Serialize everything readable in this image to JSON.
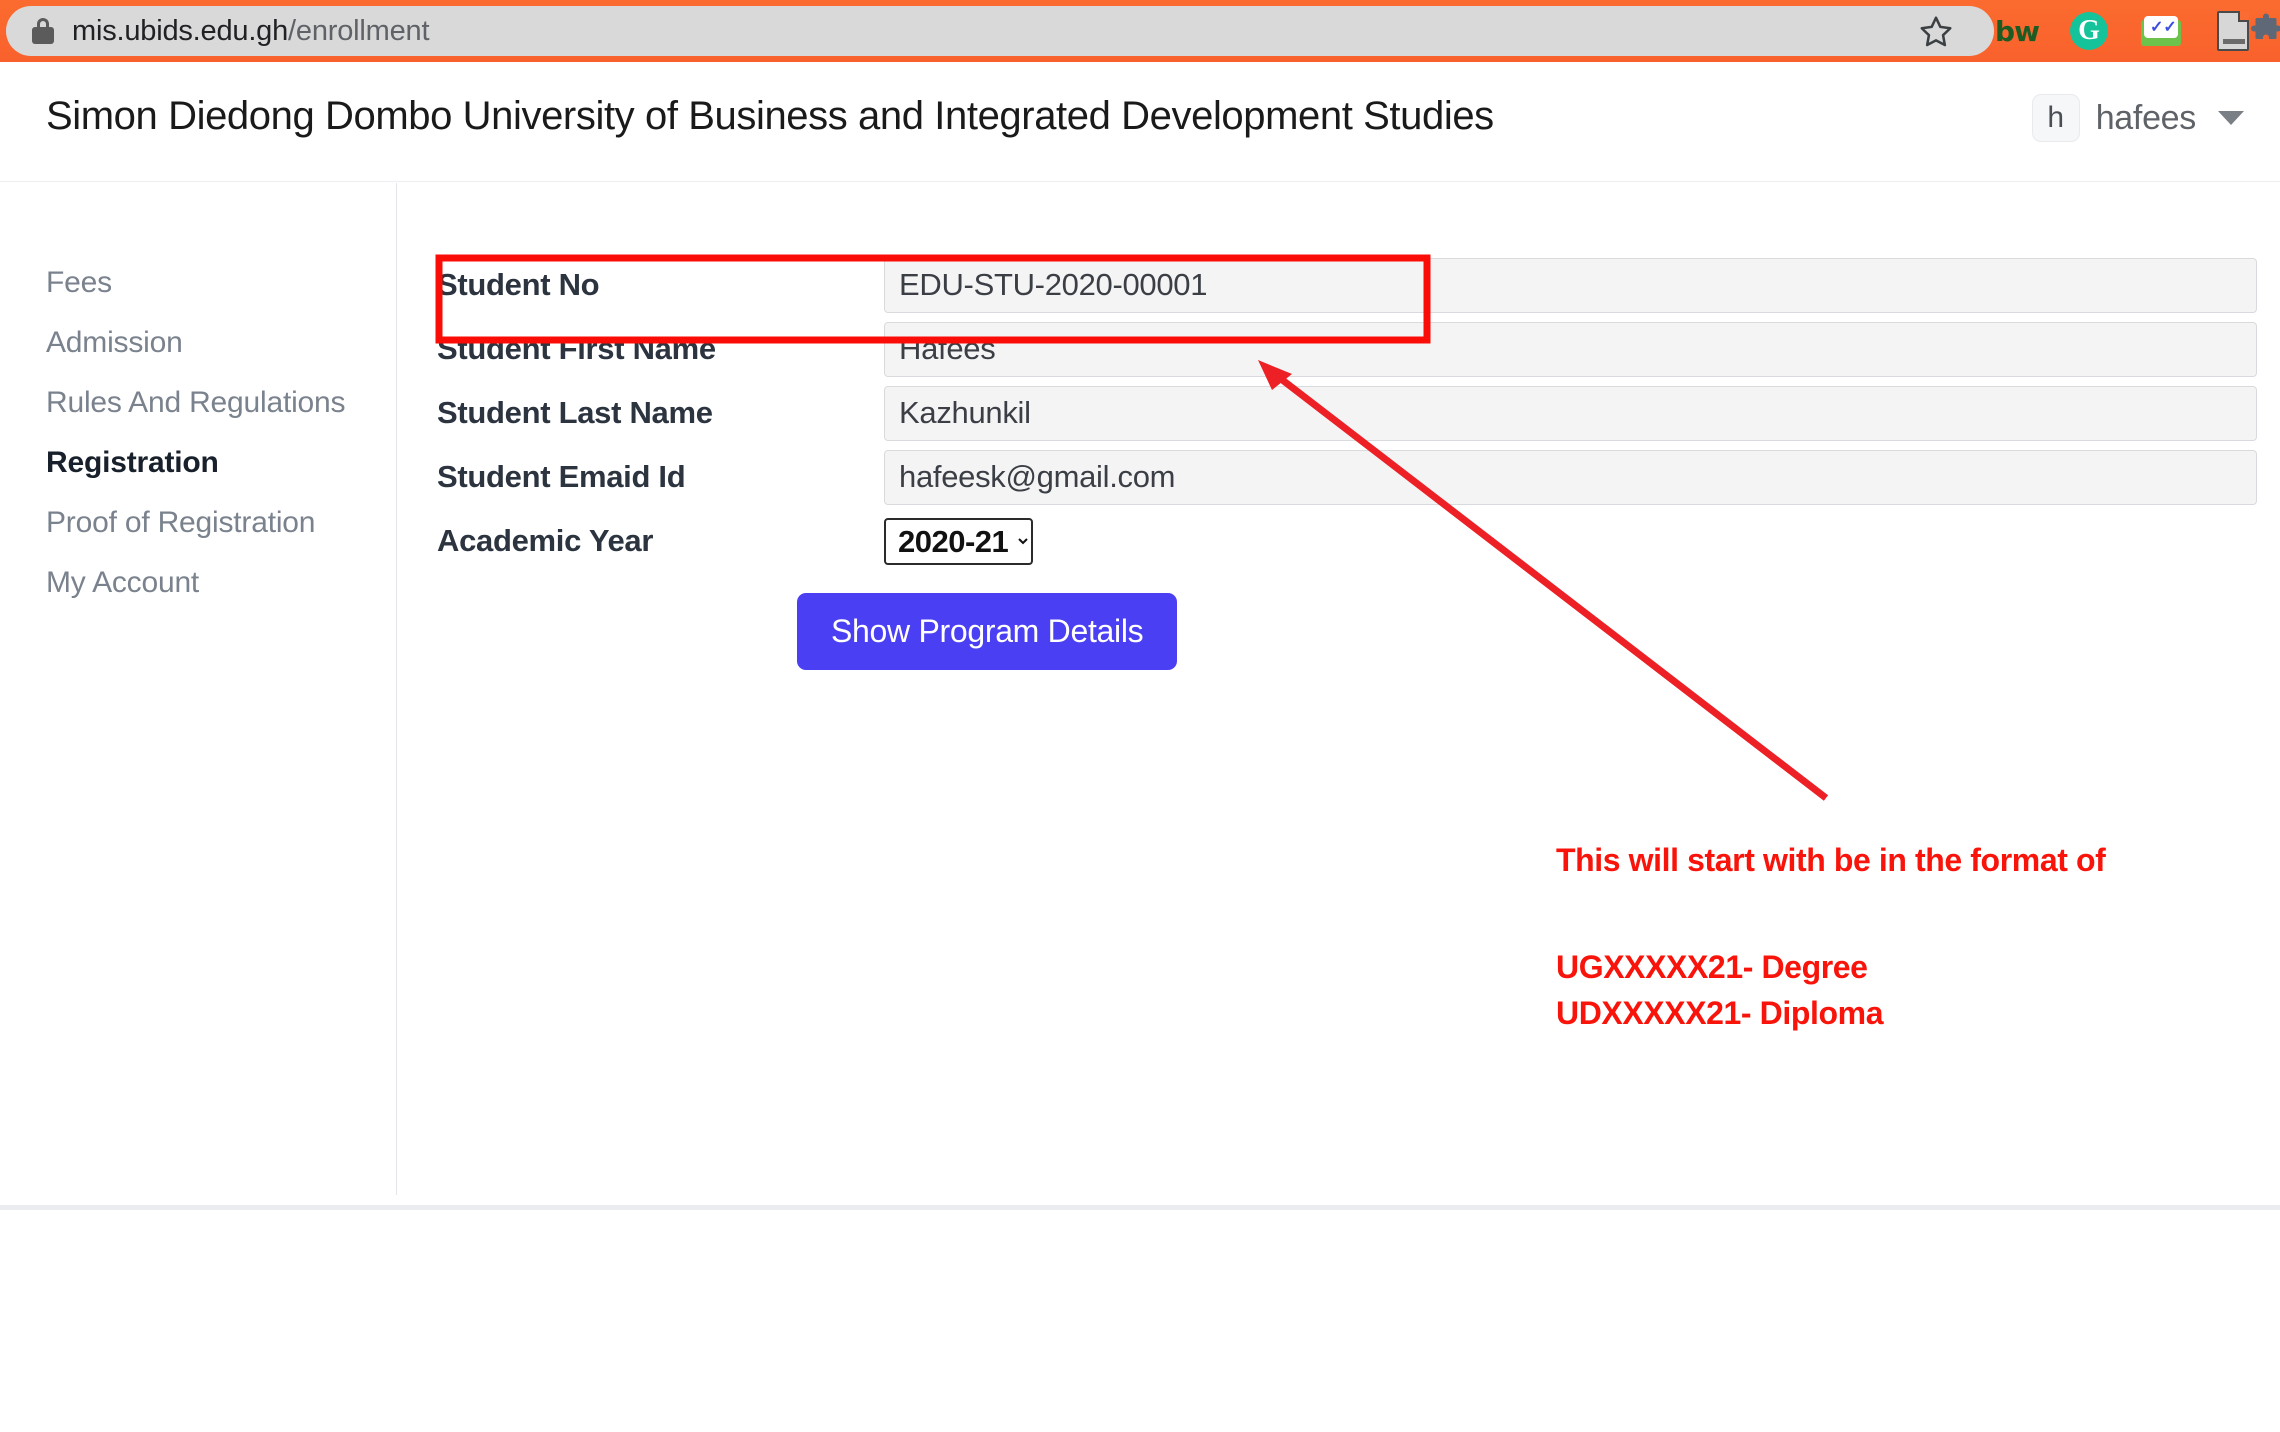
{
  "browser": {
    "url_secure": "mis.ubids.edu.gh",
    "url_path": "/enrollment",
    "lock_icon": "lock-icon",
    "star_icon": "bookmark-star-icon",
    "extensions": [
      {
        "name": "bitwarden-icon",
        "label": "bw"
      },
      {
        "name": "grammarly-icon",
        "label": "G"
      },
      {
        "name": "mail-icon",
        "label": "✓✓"
      },
      {
        "name": "document-icon",
        "label": ""
      },
      {
        "name": "puzzle-extensions-icon",
        "label": ""
      }
    ],
    "chrome_color": "#fa6c33"
  },
  "header": {
    "title": "Simon Diedong Dombo University of Business and Integrated Development Studies",
    "user": {
      "initial": "h",
      "name": "hafees",
      "caret_icon": "chevron-down-icon"
    }
  },
  "sidebar": {
    "items": [
      {
        "label": "Fees",
        "active": false
      },
      {
        "label": "Admission",
        "active": false
      },
      {
        "label": "Rules And Regulations",
        "active": false
      },
      {
        "label": "Registration",
        "active": true
      },
      {
        "label": "Proof of Registration",
        "active": false
      },
      {
        "label": "My Account",
        "active": false
      }
    ]
  },
  "form": {
    "rows": [
      {
        "label": "Student No",
        "value": "EDU-STU-2020-00001",
        "type": "text"
      },
      {
        "label": "Student First Name",
        "value": "Hafees",
        "type": "text"
      },
      {
        "label": "Student Last Name",
        "value": "Kazhunkil",
        "type": "text"
      },
      {
        "label": "Student Emaid Id",
        "value": "hafeesk@gmail.com",
        "type": "text"
      },
      {
        "label": "Academic Year",
        "value": "2020-21",
        "type": "select",
        "options": [
          "2020-21"
        ]
      }
    ],
    "submit_label": "Show Program Details",
    "submit_color": "#4a3ff2"
  },
  "annotation": {
    "color": "#f8140a",
    "line1": "This will start with be in the format of",
    "line2": "UGXXXXX21- Degree",
    "line3": "UDXXXXX21- Diploma",
    "highlight_target": "Student No",
    "arrow_icon": "red-arrow-annotation",
    "box_icon": "red-highlight-box"
  }
}
